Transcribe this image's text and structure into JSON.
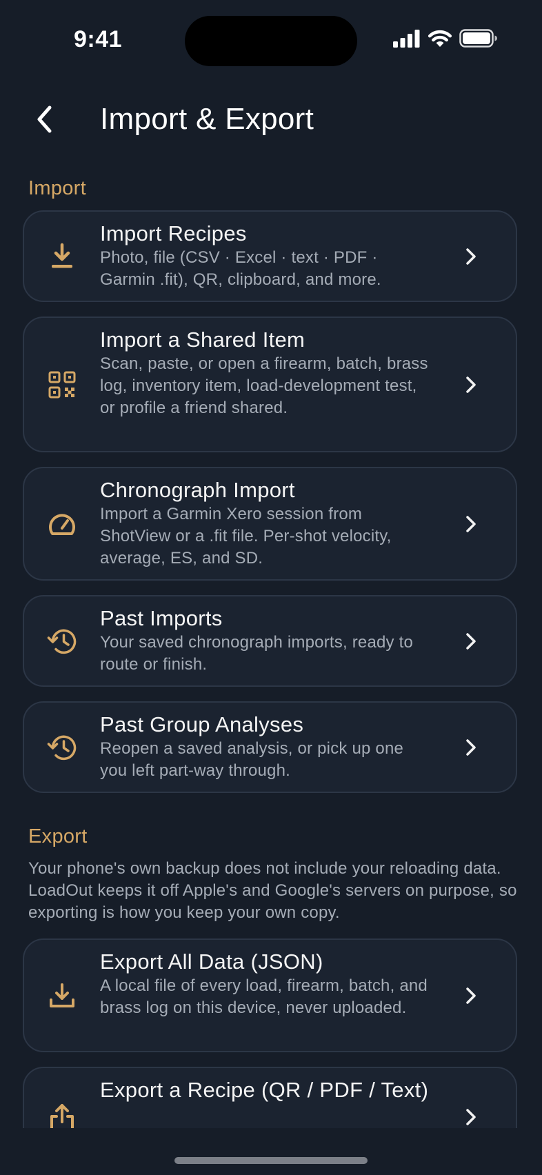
{
  "status_bar": {
    "time": "9:41"
  },
  "nav": {
    "title": "Import & Export"
  },
  "import_section": {
    "header": "Import",
    "items": [
      {
        "icon": "download-tray-icon",
        "title": "Import Recipes",
        "subtitle": "Photo, file (CSV · Excel · text · PDF · Garmin .fit), QR, clipboard, and more."
      },
      {
        "icon": "qr-code-icon",
        "title": "Import a Shared Item",
        "subtitle": "Scan, paste, or open a firearm, batch, brass log, inventory item, load-development test, or profile a friend shared."
      },
      {
        "icon": "speedometer-icon",
        "title": "Chronograph Import",
        "subtitle": "Import a Garmin Xero session from ShotView or a .fit file. Per-shot velocity, average, ES, and SD."
      },
      {
        "icon": "history-icon",
        "title": "Past Imports",
        "subtitle": "Your saved chronograph imports, ready to route or finish."
      },
      {
        "icon": "history-icon",
        "title": "Past Group Analyses",
        "subtitle": "Reopen a saved analysis, or pick up one you left part-way through."
      }
    ]
  },
  "export_section": {
    "header": "Export",
    "description": "Your phone's own backup does not include your reloading data. LoadOut keeps it off Apple's and Google's servers on purpose, so exporting is how you keep your own copy.",
    "items": [
      {
        "icon": "download-icon",
        "title": "Export All Data (JSON)",
        "subtitle": "A local file of every load, firearm, batch, and brass log on this device, never uploaded."
      },
      {
        "icon": "share-icon",
        "title": "Export a Recipe (QR / PDF / Text)",
        "subtitle": ""
      }
    ]
  },
  "colors": {
    "background": "#161d28",
    "card_background": "#1b2330",
    "card_border": "#2c3646",
    "accent": "#d6a866",
    "secondary_text": "#a5acb6"
  }
}
